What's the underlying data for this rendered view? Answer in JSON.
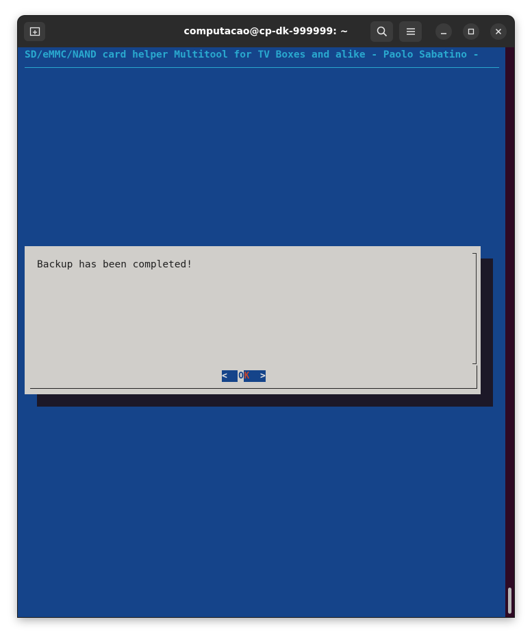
{
  "window": {
    "title": "computacao@cp-dk-999999: ~",
    "icons": {
      "new_tab": "new-tab-icon",
      "search": "search-icon",
      "menu": "hamburger-menu-icon",
      "minimize": "minimize-icon",
      "maximize": "maximize-icon",
      "close": "close-icon"
    }
  },
  "terminal": {
    "backtitle": "SD/eMMC/NAND card helper Multitool for TV Boxes and alike - Paolo Sabatino -",
    "colors": {
      "background": "#15448a",
      "backtitle": "#2aa9cf",
      "dialog": "#d0ceca",
      "hotkey": "#c5472e"
    }
  },
  "dialog": {
    "message": "Backup has been completed!",
    "ok_button": {
      "left": "<  ",
      "first": "O",
      "hotkey": "K",
      "right": "  >"
    }
  }
}
